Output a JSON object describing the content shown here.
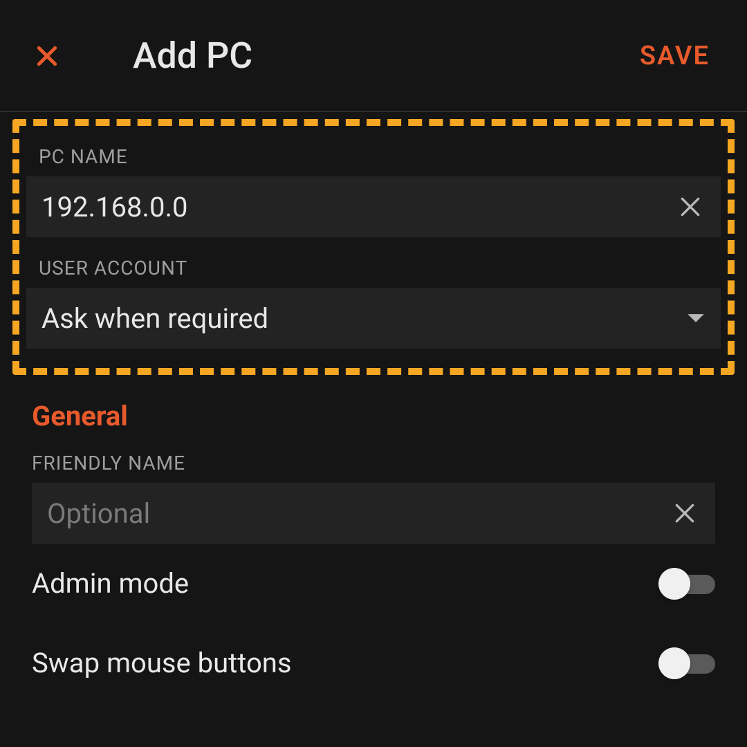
{
  "header": {
    "title": "Add PC",
    "save_label": "SAVE"
  },
  "fields": {
    "pc_name_label": "PC NAME",
    "pc_name_value": "192.168.0.0",
    "user_account_label": "USER ACCOUNT",
    "user_account_value": "Ask when required"
  },
  "section": {
    "general_label": "General",
    "friendly_name_label": "FRIENDLY NAME",
    "friendly_name_placeholder": "Optional",
    "friendly_name_value": "",
    "admin_mode_label": "Admin mode",
    "admin_mode_on": false,
    "swap_mouse_label": "Swap mouse buttons",
    "swap_mouse_on": false
  },
  "colors": {
    "accent": "#e85a2c",
    "highlight": "#f5a623",
    "bg": "#151515",
    "input_bg": "#232323"
  }
}
